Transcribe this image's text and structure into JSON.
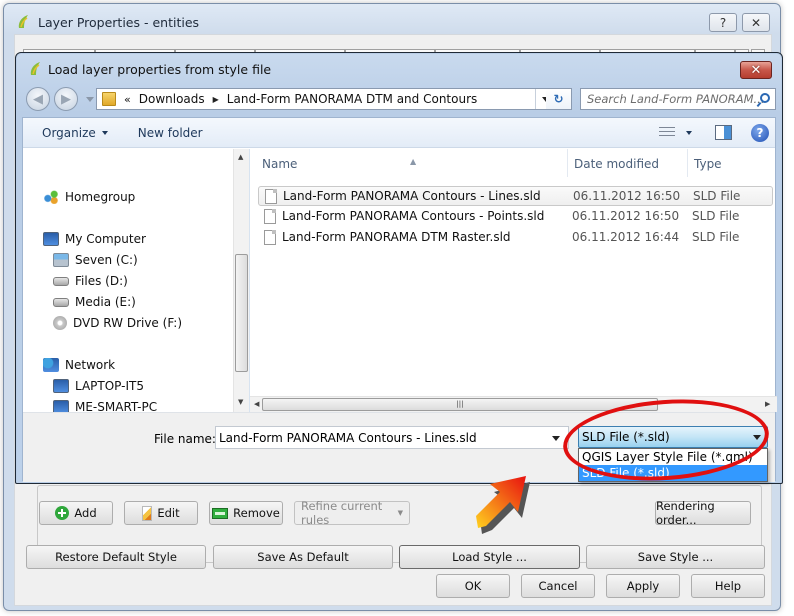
{
  "background_window": {
    "title": "Layer Properties - entities",
    "help_button": "?",
    "close_button": "✕",
    "rule_buttons": {
      "add": "Add",
      "edit": "Edit",
      "remove": "Remove",
      "refine": "Refine current rules",
      "rendering_order": "Rendering order..."
    },
    "style_buttons": {
      "restore_default": "Restore Default Style",
      "save_default": "Save As Default",
      "load_style": "Load Style ...",
      "save_style": "Save Style ..."
    },
    "dialog_buttons": {
      "ok": "OK",
      "cancel": "Cancel",
      "apply": "Apply",
      "help": "Help"
    }
  },
  "file_dialog": {
    "title": "Load layer properties from style file",
    "close_button": "✕",
    "breadcrumb": {
      "overflow": "«",
      "segments": [
        "Downloads",
        "Land-Form PANORAMA DTM and Contours"
      ],
      "separator": "▶"
    },
    "search_placeholder": "Search Land-Form PANORAM...",
    "toolbar": {
      "organize": "Organize",
      "new_folder": "New folder"
    },
    "nav_pane": {
      "homegroup": "Homegroup",
      "computer": {
        "label": "My Computer",
        "drives": [
          "Seven (C:)",
          "Files (D:)",
          "Media (E:)",
          "DVD RW Drive (F:)"
        ]
      },
      "network": {
        "label": "Network",
        "hosts": [
          "LAPTOP-IT5",
          "ME-SMART-PC"
        ]
      }
    },
    "columns": {
      "name": "Name",
      "date_modified": "Date modified",
      "type": "Type"
    },
    "files": [
      {
        "name": "Land-Form PANORAMA Contours - Lines.sld",
        "date": "06.11.2012 16:50",
        "type": "SLD File"
      },
      {
        "name": "Land-Form PANORAMA Contours - Points.sld",
        "date": "06.11.2012 16:50",
        "type": "SLD File"
      },
      {
        "name": "Land-Form PANORAMA DTM Raster.sld",
        "date": "06.11.2012 16:44",
        "type": "SLD File"
      }
    ],
    "file_name_label": "File name:",
    "file_name_value": "Land-Form PANORAMA Contours - Lines.sld",
    "file_type": {
      "selected": "SLD File (*.sld)",
      "options": [
        "QGIS Layer Style File (*.qml)",
        "SLD File (*.sld)"
      ]
    }
  },
  "annotation_colors": {
    "highlight_ellipse": "#e01010",
    "arrow_gradient": [
      "#ffd21f",
      "#e8100f"
    ]
  }
}
